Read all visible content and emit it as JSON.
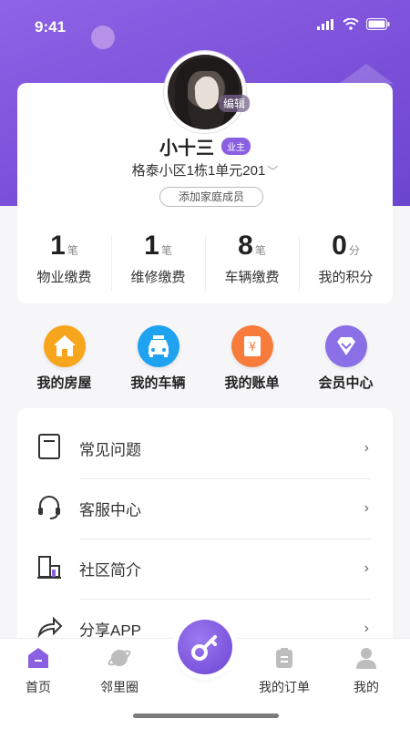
{
  "status": {
    "time": "9:41"
  },
  "profile": {
    "edit_label": "编辑",
    "name": "小十三",
    "badge": "业主",
    "address": "格泰小区1栋1单元201",
    "add_family": "添加家庭成员"
  },
  "stats": [
    {
      "num": "1",
      "unit": "笔",
      "label": "物业缴费"
    },
    {
      "num": "1",
      "unit": "笔",
      "label": "维修缴费"
    },
    {
      "num": "8",
      "unit": "笔",
      "label": "车辆缴费"
    },
    {
      "num": "0",
      "unit": "分",
      "label": "我的积分"
    }
  ],
  "quick_actions": [
    {
      "label": "我的房屋",
      "icon": "house-icon",
      "color": "#f7a51c"
    },
    {
      "label": "我的车辆",
      "icon": "car-icon",
      "color": "#1fa3f0"
    },
    {
      "label": "我的账单",
      "icon": "bill-icon",
      "color": "#f77b3b"
    },
    {
      "label": "会员中心",
      "icon": "diamond-icon",
      "color": "#8a6fe6"
    }
  ],
  "menu": [
    {
      "label": "常见问题",
      "icon": "document-icon"
    },
    {
      "label": "客服中心",
      "icon": "headset-icon"
    },
    {
      "label": "社区简介",
      "icon": "building-icon"
    },
    {
      "label": "分享APP",
      "icon": "share-icon"
    }
  ],
  "tabs": [
    {
      "label": "首页",
      "icon": "home-tab-icon"
    },
    {
      "label": "邻里圈",
      "icon": "planet-icon"
    },
    {
      "label": "我的订单",
      "icon": "order-icon"
    },
    {
      "label": "我的",
      "icon": "user-icon"
    }
  ],
  "colors": {
    "accent": "#7a4fd8",
    "badge": "#8a5fe2"
  }
}
